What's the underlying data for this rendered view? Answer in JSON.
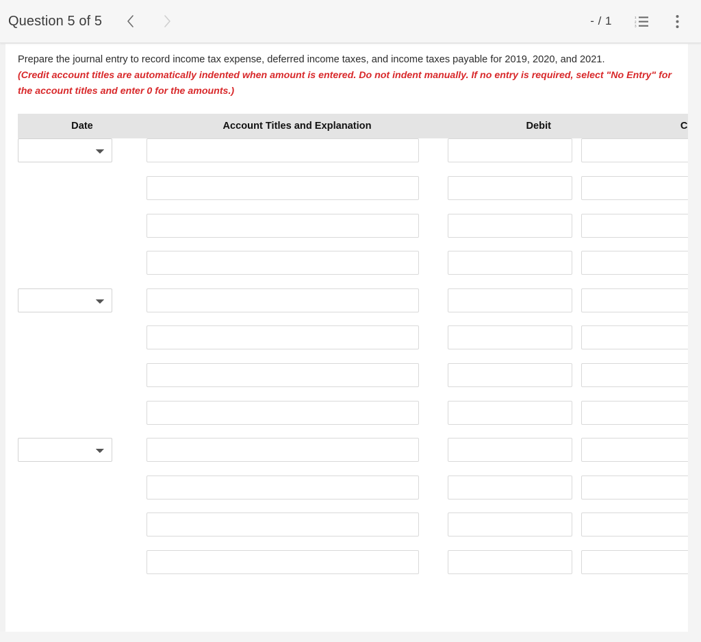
{
  "header": {
    "question_title": "Question 5 of 5",
    "prev_label": "‹",
    "next_label": "›",
    "score": "- / 1",
    "list_icon_name": "numbered-list-icon",
    "menu_icon_name": "kebab-menu-icon"
  },
  "prompt": {
    "main": "Prepare the journal entry to record income tax expense, deferred income taxes, and income taxes payable for 2019, 2020, and 2021.",
    "note": "(Credit account titles are automatically indented when amount is entered. Do not indent manually. If no entry is required, select \"No Entry\" for the account titles and enter 0 for the amounts.)"
  },
  "table": {
    "columns": [
      "Date",
      "Account Titles and Explanation",
      "Debit",
      "Credit"
    ],
    "date_select_value": "",
    "date_select_options": [
      ""
    ],
    "rows": [
      {
        "has_date": true,
        "date": "",
        "account": "",
        "debit": "",
        "credit": ""
      },
      {
        "has_date": false,
        "date": "",
        "account": "",
        "debit": "",
        "credit": ""
      },
      {
        "has_date": false,
        "date": "",
        "account": "",
        "debit": "",
        "credit": ""
      },
      {
        "has_date": false,
        "date": "",
        "account": "",
        "debit": "",
        "credit": ""
      },
      {
        "has_date": true,
        "date": "",
        "account": "",
        "debit": "",
        "credit": ""
      },
      {
        "has_date": false,
        "date": "",
        "account": "",
        "debit": "",
        "credit": ""
      },
      {
        "has_date": false,
        "date": "",
        "account": "",
        "debit": "",
        "credit": ""
      },
      {
        "has_date": false,
        "date": "",
        "account": "",
        "debit": "",
        "credit": ""
      },
      {
        "has_date": true,
        "date": "",
        "account": "",
        "debit": "",
        "credit": ""
      },
      {
        "has_date": false,
        "date": "",
        "account": "",
        "debit": "",
        "credit": ""
      },
      {
        "has_date": false,
        "date": "",
        "account": "",
        "debit": "",
        "credit": ""
      },
      {
        "has_date": false,
        "date": "",
        "account": "",
        "debit": "",
        "credit": ""
      }
    ]
  },
  "colors": {
    "note_red": "#d8282a",
    "header_bg": "#f6f6f6",
    "table_head_bg": "#e4e4e4",
    "page_bg": "#f2f2f2"
  }
}
